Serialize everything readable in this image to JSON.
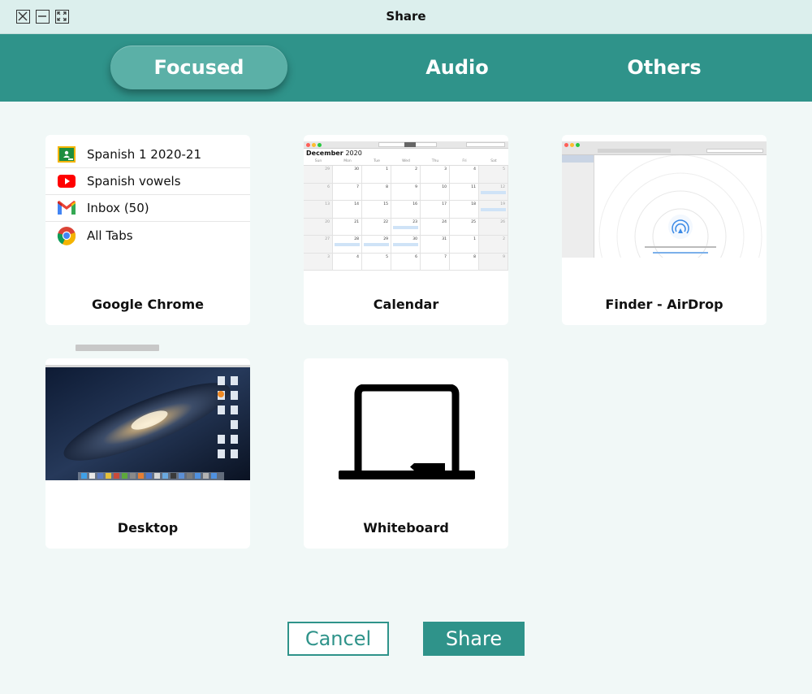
{
  "window": {
    "title": "Share"
  },
  "tabs": [
    {
      "label": "Focused",
      "active": true
    },
    {
      "label": "Audio",
      "active": false
    },
    {
      "label": "Others",
      "active": false
    }
  ],
  "sources": [
    {
      "label": "Google Chrome",
      "tabs": [
        {
          "icon": "google-classroom-icon",
          "title": "Spanish 1 2020-21"
        },
        {
          "icon": "youtube-icon",
          "title": "Spanish vowels"
        },
        {
          "icon": "gmail-icon",
          "title": "Inbox (50)"
        },
        {
          "icon": "chrome-icon",
          "title": "All Tabs"
        }
      ]
    },
    {
      "label": "Calendar",
      "preview": {
        "month": "December",
        "year": "2020",
        "weekdays": [
          "Sun",
          "Mon",
          "Tue",
          "Wed",
          "Thu",
          "Fri",
          "Sat"
        ],
        "dates": [
          "29",
          "30",
          "1",
          "2",
          "3",
          "4",
          "5",
          "6",
          "7",
          "8",
          "9",
          "10",
          "11",
          "12",
          "13",
          "14",
          "15",
          "16",
          "17",
          "18",
          "19",
          "20",
          "21",
          "22",
          "23",
          "24",
          "25",
          "26",
          "27",
          "28",
          "29",
          "30",
          "31",
          "1",
          "2",
          "3",
          "4",
          "5",
          "6",
          "7",
          "8",
          "9"
        ]
      }
    },
    {
      "label": "Finder - AirDrop"
    },
    {
      "label": "Desktop"
    },
    {
      "label": "Whiteboard"
    }
  ],
  "actions": {
    "cancel": "Cancel",
    "share": "Share"
  },
  "colors": {
    "accent": "#2f938a",
    "tab_active": "#5bb0a7",
    "titlebar": "#dcefed",
    "background": "#f1f8f7"
  }
}
